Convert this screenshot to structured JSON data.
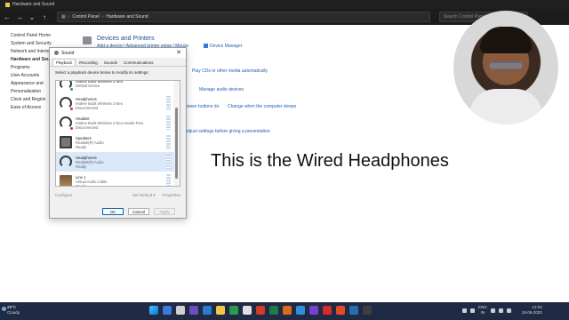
{
  "window": {
    "title": "Hardware and Sound",
    "address": [
      "Control Panel",
      "Hardware and Sound"
    ],
    "search_placeholder": "Search Control Panel"
  },
  "left_nav": [
    {
      "label": "Control Panel Home",
      "active": false
    },
    {
      "label": "System and Security",
      "active": false
    },
    {
      "label": "Network and Internet",
      "active": false
    },
    {
      "label": "Hardware and Sound",
      "active": true
    },
    {
      "label": "Programs",
      "active": false
    },
    {
      "label": "User Accounts",
      "active": false
    },
    {
      "label": "Appearance and",
      "active": false
    },
    {
      "label": "Personalization",
      "active": false
    },
    {
      "label": "Clock and Region",
      "active": false
    },
    {
      "label": "Ease of Access",
      "active": false
    }
  ],
  "control_panel": {
    "heading": "Devices and Printers",
    "sublinks": "Add a device  |  Advanced printer setup  |  Mouse",
    "device_manager": "Device Manager",
    "play_cds": "Play CDs or other media automatically",
    "manage_audio": "Manage audio devices",
    "power_buttons": "power buttons do",
    "change_sleep": "Change when the computer sleeps",
    "presentation": "Adjust settings before giving a presentation"
  },
  "overlay_text": "This is the Wired Headphones",
  "sound_dialog": {
    "title": "Sound",
    "close": "✕",
    "tabs": [
      "Playback",
      "Recording",
      "Sounds",
      "Communications"
    ],
    "active_tab": 0,
    "instruction": "Select a playback device below to modify its settings:",
    "devices": [
      {
        "name": "realme Buds Wireless 2 Neo",
        "desc": "Default Device",
        "status": "",
        "kind": "headphones",
        "badge": "green",
        "selected": false
      },
      {
        "name": "Headphones",
        "desc": "realme Buds Wireless 2 Neo",
        "status": "Disconnected",
        "kind": "headphones",
        "badge": "red",
        "selected": false
      },
      {
        "name": "Headset",
        "desc": "realme Buds Wireless 2 Neo Hands-Free",
        "status": "Disconnected",
        "kind": "headphones",
        "badge": "red",
        "selected": false
      },
      {
        "name": "Speakers",
        "desc": "Realtek(R) Audio",
        "status": "Ready",
        "kind": "speaker",
        "badge": "",
        "selected": false
      },
      {
        "name": "Headphones",
        "desc": "Realtek(R) Audio",
        "status": "Ready",
        "kind": "headphones",
        "badge": "",
        "selected": true
      },
      {
        "name": "Line 1",
        "desc": "Virtual Audio Cable",
        "status": "Ready",
        "kind": "line",
        "badge": "",
        "selected": false
      }
    ],
    "configure": "Configure",
    "set_default": "Set Default ▾",
    "properties": "Properties",
    "ok": "OK",
    "cancel": "Cancel",
    "apply": "Apply"
  },
  "taskbar": {
    "temperature": "29°C",
    "condition": "Cloudy",
    "lang_top": "ENG",
    "lang_bottom": "IN",
    "time": "12:04",
    "date": "18-05-2022",
    "app_colors": [
      "#3a7bd5",
      "#d0d0d0",
      "#6b4fbb",
      "#2a7ad0",
      "#f2c744",
      "#2b9b4a",
      "#e0e0e0",
      "#d23c2a",
      "#1e7b46",
      "#d96a1e",
      "#2f8fd8",
      "#7a3fd1",
      "#d62b2b",
      "#e34c26",
      "#2b6cb0",
      "#3e3e3e"
    ]
  }
}
